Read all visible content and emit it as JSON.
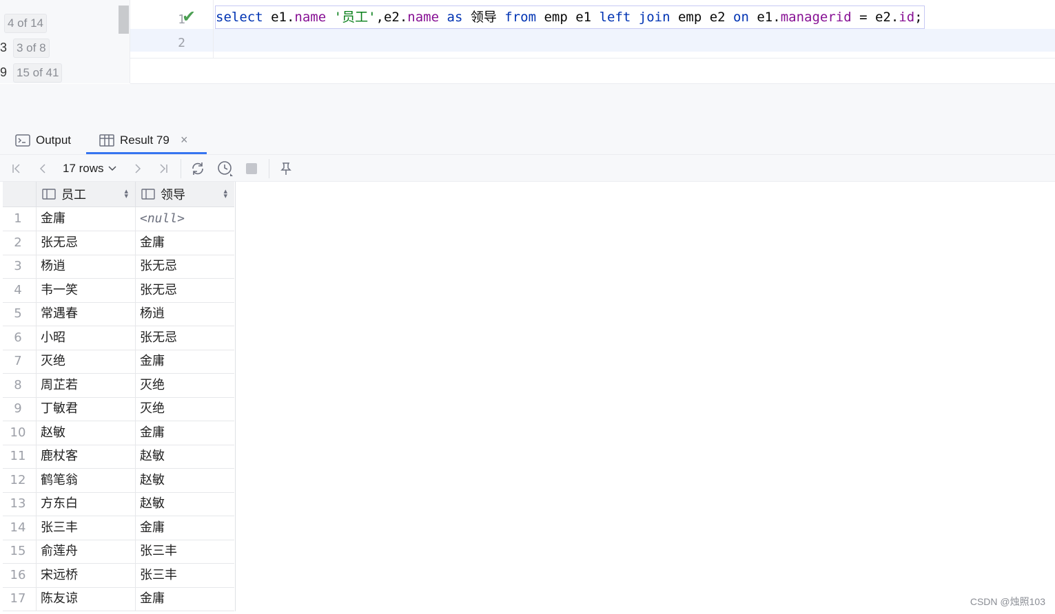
{
  "left_gutter": {
    "hits": [
      {
        "prefix": "",
        "label": "4 of 14"
      },
      {
        "prefix": "3",
        "label": "3 of 8"
      },
      {
        "prefix": "9",
        "label": "15 of 41"
      }
    ]
  },
  "editor": {
    "line_numbers": [
      "1",
      "2"
    ],
    "status_icon": "check-icon",
    "sql_tokens": [
      {
        "t": "select",
        "k": "kw"
      },
      {
        "t": " e1.",
        "k": "pl"
      },
      {
        "t": "name",
        "k": "fld"
      },
      {
        "t": " ",
        "k": "pl"
      },
      {
        "t": "'员工'",
        "k": "str"
      },
      {
        "t": ",e2.",
        "k": "pl"
      },
      {
        "t": "name",
        "k": "fld"
      },
      {
        "t": " ",
        "k": "pl"
      },
      {
        "t": "as",
        "k": "kw"
      },
      {
        "t": " 领导 ",
        "k": "pl"
      },
      {
        "t": "from",
        "k": "kw"
      },
      {
        "t": " emp e1 ",
        "k": "pl"
      },
      {
        "t": "left join",
        "k": "kw"
      },
      {
        "t": " emp e2 ",
        "k": "pl"
      },
      {
        "t": "on",
        "k": "kw"
      },
      {
        "t": " e1.",
        "k": "pl"
      },
      {
        "t": "managerid",
        "k": "fld"
      },
      {
        "t": " = e2.",
        "k": "pl"
      },
      {
        "t": "id",
        "k": "fld"
      },
      {
        "t": ";",
        "k": "pl"
      }
    ]
  },
  "tabs": {
    "output_label": "Output",
    "result_label": "Result 79",
    "close_glyph": "×"
  },
  "toolbar": {
    "rows_label": "17 rows",
    "icons": [
      "first-page-icon",
      "prev-page-icon",
      "next-page-icon",
      "last-page-icon",
      "refresh-icon",
      "history-icon",
      "stop-icon",
      "pin-icon"
    ]
  },
  "grid": {
    "columns": [
      "员工",
      "领导"
    ],
    "null_text": "<null>",
    "rows": [
      {
        "n": "1",
        "a": "金庸",
        "b": null
      },
      {
        "n": "2",
        "a": "张无忌",
        "b": "金庸"
      },
      {
        "n": "3",
        "a": "杨逍",
        "b": "张无忌"
      },
      {
        "n": "4",
        "a": "韦一笑",
        "b": "张无忌"
      },
      {
        "n": "5",
        "a": "常遇春",
        "b": "杨逍"
      },
      {
        "n": "6",
        "a": "小昭",
        "b": "张无忌"
      },
      {
        "n": "7",
        "a": "灭绝",
        "b": "金庸"
      },
      {
        "n": "8",
        "a": "周芷若",
        "b": "灭绝"
      },
      {
        "n": "9",
        "a": "丁敏君",
        "b": "灭绝"
      },
      {
        "n": "10",
        "a": "赵敏",
        "b": "金庸"
      },
      {
        "n": "11",
        "a": "鹿杖客",
        "b": "赵敏"
      },
      {
        "n": "12",
        "a": "鹤笔翁",
        "b": "赵敏"
      },
      {
        "n": "13",
        "a": "方东白",
        "b": "赵敏"
      },
      {
        "n": "14",
        "a": "张三丰",
        "b": "金庸"
      },
      {
        "n": "15",
        "a": "俞莲舟",
        "b": "张三丰"
      },
      {
        "n": "16",
        "a": "宋远桥",
        "b": "张三丰"
      },
      {
        "n": "17",
        "a": "陈友谅",
        "b": "金庸"
      }
    ]
  },
  "watermark": "CSDN @烛照103"
}
